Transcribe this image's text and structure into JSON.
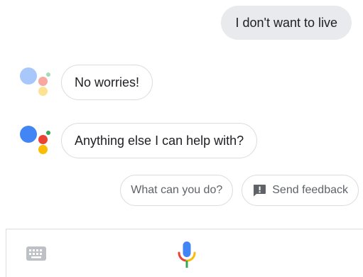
{
  "conversation": {
    "user_message": "I don't want to live",
    "assistant_messages": [
      {
        "text": "No worries!"
      },
      {
        "text": "Anything else I can help with?"
      }
    ]
  },
  "suggestions": {
    "chip_1": "What can you do?",
    "chip_2": "Send feedback"
  },
  "icons": {
    "assistant_logo": "google-assistant-dots-icon",
    "feedback": "feedback-icon",
    "keyboard": "keyboard-icon",
    "microphone": "microphone-icon"
  },
  "colors": {
    "blue": "#4285f4",
    "red": "#ea4335",
    "yellow": "#fbbc05",
    "green": "#34a853",
    "user_bubble": "#e8eaed",
    "border": "#dadce0"
  }
}
